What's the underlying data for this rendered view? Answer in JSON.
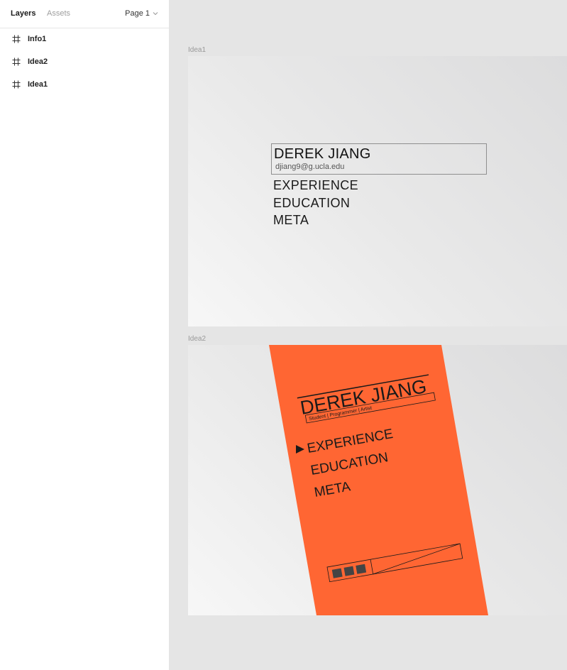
{
  "sidebar": {
    "tabs": {
      "layers": "Layers",
      "assets": "Assets"
    },
    "page_select": "Page 1",
    "layers": [
      {
        "label": "Info1"
      },
      {
        "label": "Idea2"
      },
      {
        "label": "Idea1"
      }
    ]
  },
  "canvas": {
    "idea1": {
      "label": "Idea1",
      "name": "DEREK JIANG",
      "email": "djiang9@g.ucla.edu",
      "menu": [
        "EXPERIENCE",
        "EDUCATION",
        "META"
      ]
    },
    "idea2": {
      "label": "Idea2",
      "name": "DEREK JIANG",
      "subtitle": "Student | Programmer | Artist",
      "menu": [
        "EXPERIENCE",
        "EDUCATION",
        "META"
      ],
      "accent": "#ff6633"
    }
  }
}
